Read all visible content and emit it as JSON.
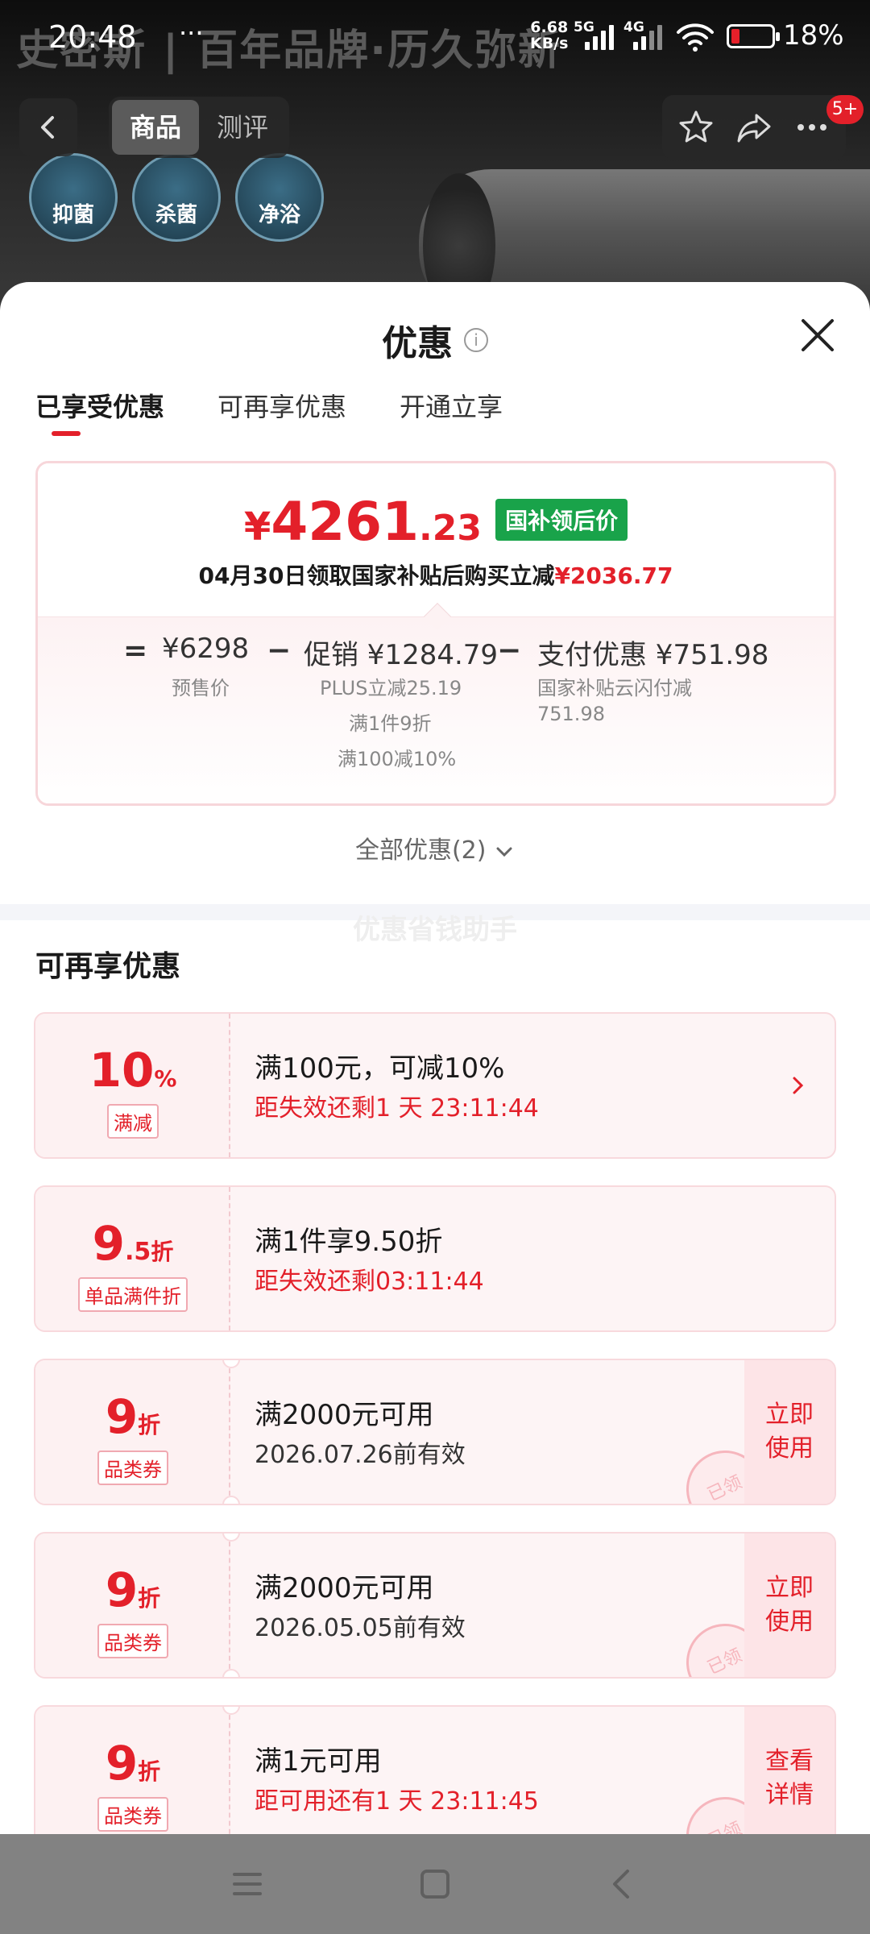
{
  "status_bar": {
    "time": "20:48",
    "dots": "···",
    "net_speed_value": "6.68",
    "net_speed_unit": "KB/s",
    "sim1_label": "5G",
    "sim2_label": "4G",
    "battery_percent": "18%"
  },
  "background": {
    "banner": "史密斯 | 百年品牌·历久弥新",
    "features": [
      "抑菌",
      "杀菌",
      "净浴"
    ]
  },
  "header": {
    "tabs": [
      "商品",
      "测评"
    ],
    "active_tab": "商品",
    "cart_badge": "5+"
  },
  "sheet": {
    "title": "优惠",
    "tabs": [
      "已享受优惠",
      "可再享优惠",
      "开通立享"
    ],
    "price": {
      "currency": "¥",
      "integer": "4261",
      "decimal": ".23",
      "tag": "国补领后价",
      "sub_text": "04月30日领取国家补贴后购买立减",
      "sub_amount": "¥2036.77"
    },
    "breakdown": {
      "equals": "=",
      "presale_value": "¥6298",
      "presale_label": "预售价",
      "minus1": "−",
      "promo_value": "促销 ¥1284.79",
      "promo_notes": [
        "PLUS立减25.19",
        "满1件9折",
        "满100减10%"
      ],
      "minus2": "−",
      "payment_value": "支付优惠 ¥751.98",
      "payment_notes": [
        "国家补贴云闪付减",
        "751.98"
      ]
    },
    "all_discounts": "全部优惠(2)",
    "watermark": "优惠省钱助手",
    "section_title": "可再享优惠",
    "coupons": [
      {
        "num": "10",
        "dec": "",
        "unit": "%",
        "tag": "满减",
        "title": "满100元，可减10%",
        "sub": "距失效还剩1 天 23:11:44",
        "sub_style": "red",
        "action": ""
      },
      {
        "num": "9",
        "dec": ".5",
        "unit": "折",
        "tag": "单品满件折",
        "title": "满1件享9.50折",
        "sub": "距失效还剩03:11:44",
        "sub_style": "red",
        "action": ""
      },
      {
        "num": "9",
        "dec": "",
        "unit": "折",
        "tag": "品类券",
        "title": "满2000元可用",
        "sub": "2026.07.26前有效",
        "sub_style": "dark",
        "action": "立即\n使用",
        "stamp": "已领"
      },
      {
        "num": "9",
        "dec": "",
        "unit": "折",
        "tag": "品类券",
        "title": "满2000元可用",
        "sub": "2026.05.05前有效",
        "sub_style": "dark",
        "action": "立即\n使用",
        "stamp": "已领"
      },
      {
        "num": "9",
        "dec": "",
        "unit": "折",
        "tag": "品类券",
        "title": "满1元可用",
        "sub": "距可用还有1 天 23:11:45",
        "sub_style": "red",
        "action": "查看\n详情",
        "stamp": "已领"
      }
    ]
  },
  "colors": {
    "accent": "#e3202a",
    "green_tag": "#19a34a",
    "coupon_bg": "#fdf4f5"
  },
  "icons": [
    "back-icon",
    "star-icon",
    "share-icon",
    "more-icon",
    "info-icon",
    "close-icon",
    "chevron-down-icon",
    "chevron-right-icon",
    "menu-icon",
    "home-icon",
    "nav-back-icon"
  ]
}
